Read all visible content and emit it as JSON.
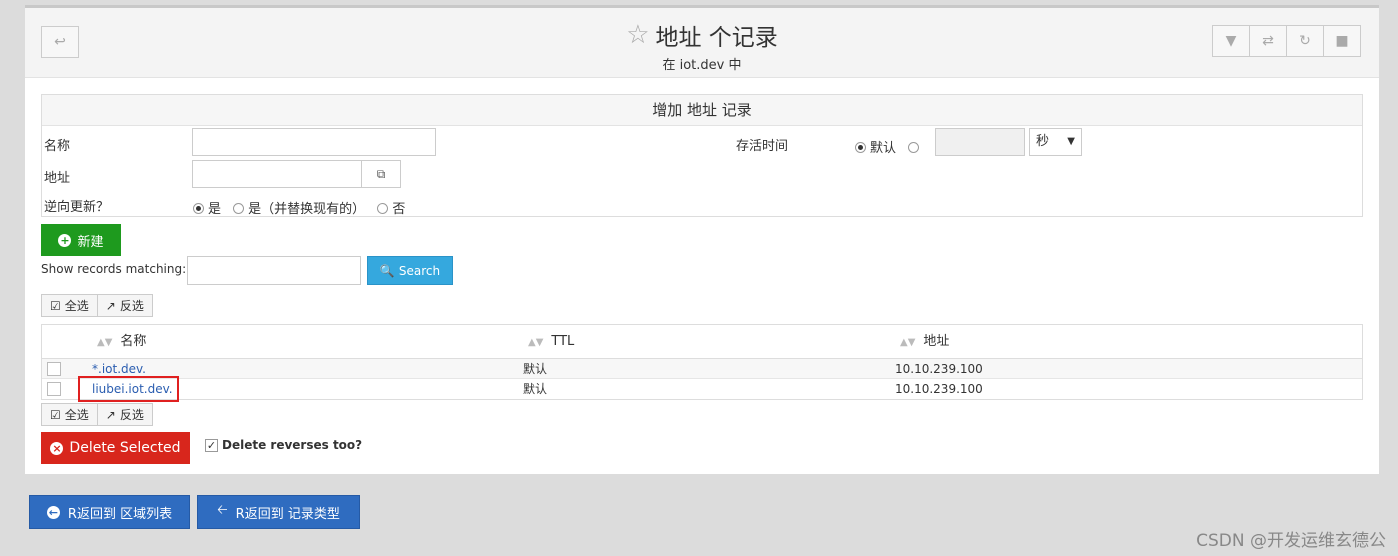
{
  "header": {
    "title": "地址 个记录",
    "subtitle": "在 iot.dev 中",
    "icons": [
      "back-arrow-icon",
      "filter-icon",
      "swap-icon",
      "refresh-icon",
      "stop-icon"
    ]
  },
  "form": {
    "heading": "增加 地址 记录",
    "name_label": "名称",
    "address_label": "地址",
    "reverse_label": "逆向更新？",
    "reverse_options": [
      "是",
      "是（并替换现有的）",
      "否"
    ],
    "ttl_label": "存活时间",
    "ttl_default": "默认",
    "ttl_unit": "秒"
  },
  "actions": {
    "new_label": "新建",
    "search_prompt": "Show records matching:",
    "search_label": "Search",
    "select_all": "全选",
    "invert": "反选",
    "delete_label": "Delete Selected",
    "delete_reverses": "Delete reverses too?"
  },
  "table": {
    "columns": [
      "名称",
      "TTL",
      "地址"
    ],
    "rows": [
      {
        "name": "*.iot.dev.",
        "ttl": "默认",
        "address": "10.10.239.100"
      },
      {
        "name": "liubei.iot.dev.",
        "ttl": "默认",
        "address": "10.10.239.100"
      }
    ]
  },
  "footer": {
    "back_zones": "R返回到 区域列表",
    "back_types": "R返回到 记录类型",
    "watermark": "CSDN @开发运维玄德公"
  },
  "colors": {
    "green": "#1e9a1e",
    "blue": "#35a8de",
    "red": "#d8261c",
    "footer_blue": "#2f6cc0",
    "highlight": "#e02020"
  }
}
